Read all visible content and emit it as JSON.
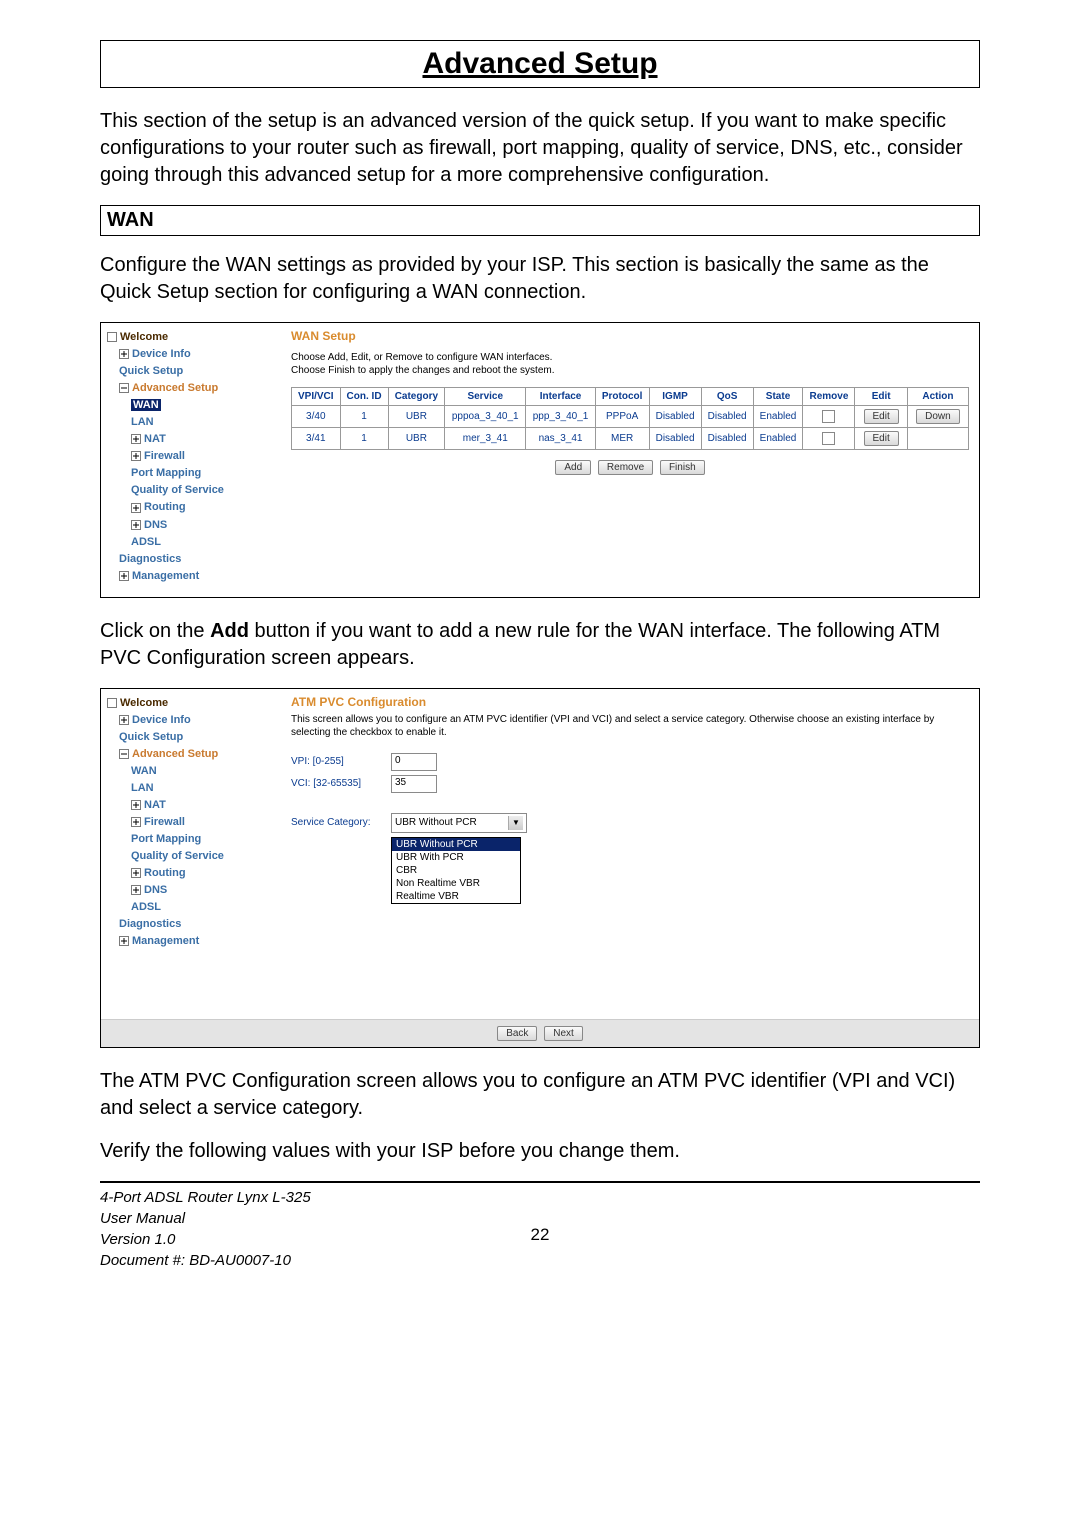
{
  "title": "Advanced Setup",
  "intro": "This section of the setup is an advanced version of the quick setup.  If you want to make specific configurations to your router such as firewall, port mapping, quality of service, DNS, etc., consider going through this advanced setup for a more comprehensive configuration.",
  "wan_heading": "WAN",
  "wan_intro": "Configure the WAN settings as provided by your ISP.  This section is basically the same as the Quick Setup section for configuring a WAN connection.",
  "tree": {
    "welcome": "Welcome",
    "device_info": "Device Info",
    "quick_setup": "Quick Setup",
    "advanced_setup": "Advanced Setup",
    "wan": "WAN",
    "lan": "LAN",
    "nat": "NAT",
    "firewall": "Firewall",
    "port_mapping": "Port Mapping",
    "qos": "Quality of Service",
    "routing": "Routing",
    "dns": "DNS",
    "adsl": "ADSL",
    "diagnostics": "Diagnostics",
    "management": "Management"
  },
  "wan_pane": {
    "title": "WAN Setup",
    "desc1": "Choose Add, Edit, or Remove to configure WAN interfaces.",
    "desc2": "Choose Finish to apply the changes and reboot the system.",
    "headers": [
      "VPI/VCI",
      "Con. ID",
      "Category",
      "Service",
      "Interface",
      "Protocol",
      "IGMP",
      "QoS",
      "State",
      "Remove",
      "Edit",
      "Action"
    ],
    "rows": [
      {
        "vpivci": "3/40",
        "conid": "1",
        "cat": "UBR",
        "service": "pppoa_3_40_1",
        "iface": "ppp_3_40_1",
        "proto": "PPPoA",
        "igmp": "Disabled",
        "qos": "Disabled",
        "state": "Enabled",
        "edit": "Edit",
        "action": "Down"
      },
      {
        "vpivci": "3/41",
        "conid": "1",
        "cat": "UBR",
        "service": "mer_3_41",
        "iface": "nas_3_41",
        "proto": "MER",
        "igmp": "Disabled",
        "qos": "Disabled",
        "state": "Enabled",
        "edit": "Edit",
        "action": ""
      }
    ],
    "buttons": {
      "add": "Add",
      "remove": "Remove",
      "finish": "Finish"
    }
  },
  "mid_text": {
    "prefix": "Click on the ",
    "add": "Add",
    "rest": " button if you want to add a new rule for the WAN interface.  The following ATM PVC Configuration screen appears."
  },
  "cfg_pane": {
    "title": "ATM PVC Configuration",
    "desc": "This screen allows you to configure an ATM PVC identifier (VPI and VCI) and select a service category. Otherwise choose an existing interface by selecting the checkbox to enable it.",
    "vpi_label": "VPI: [0-255]",
    "vpi_value": "0",
    "vci_label": "VCI: [32-65535]",
    "vci_value": "35",
    "service_label": "Service Category:",
    "service_value": "UBR Without PCR",
    "options": [
      "UBR Without PCR",
      "UBR With PCR",
      "CBR",
      "Non Realtime VBR",
      "Realtime VBR"
    ],
    "back": "Back",
    "next": "Next"
  },
  "after_text1": "The ATM PVC Configuration screen allows you to configure an ATM PVC identifier (VPI and VCI) and select a service category.",
  "after_text2": "Verify the following values with your ISP before you change them.",
  "footer": {
    "l1": "4-Port ADSL Router Lynx L-325",
    "l2": "User Manual",
    "l3": "Version 1.0",
    "l4": "Document #:  BD-AU0007-10",
    "page": "22"
  }
}
